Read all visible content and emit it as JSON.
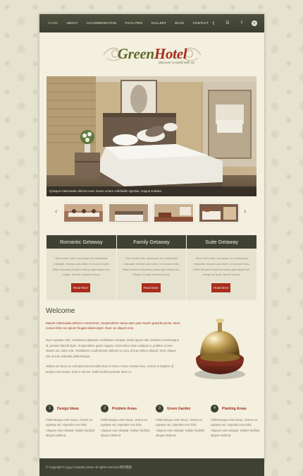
{
  "nav": {
    "items": [
      "Home",
      "About",
      "Accommodation",
      "Facilities",
      "Gallery",
      "Blog",
      "Contact"
    ],
    "active_index": 0,
    "social_icons": [
      "twitter-icon",
      "google-icon",
      "facebook-icon",
      "pinterest-icon"
    ],
    "social_glyphs": [
      "𝕥",
      "G",
      "f",
      "p"
    ]
  },
  "logo": {
    "green": "Green",
    "hotel": "Hotel",
    "tagline": "discover a world with us"
  },
  "hero": {
    "caption": "Quisque malesuada ultricies nunc maurs ornare solicitadin egestas, magna sodales."
  },
  "features": [
    {
      "title": "Romantic Getaway",
      "text": "Nunc tortor ante, accumsan vel malesuada vulputate, tempus quis dolor. In et purus nulla. Etiam tincidunt pharetra metus eget aliquet leo. Integer mi ante, laoreet cursus.",
      "button": "Read More"
    },
    {
      "title": "Family Getaway",
      "text": "Nunc tortor ante, accumsan vel malesuada vulputate, tempus quis dolor. In et purus nulla. Etiam tincidunt pharetra metus eget aliquet leo. Integer mi ante, laoreet cursus.",
      "button": "Read More"
    },
    {
      "title": "Suite Getaway",
      "text": "Nunc tortor ante, accumsan vel malesuada vulputate, tempus quis dolor. In et purus nulla. Etiam tincidunt pharetra metus eget aliquet leo. Integer mi ante, laoreet cursus.",
      "button": "Read More"
    }
  ],
  "welcome": {
    "title": "Welcome",
    "highlight": "Mauris malesuada ultricies consectetur. Suspendisse varius ante quis mauris gravida auctor. Nunc cursus felis non ipsum feugiat ullamcorper. Nunc ac aliquet eros.",
    "paragraph1": "Nunc egestas velit. Vestibulum dignissim vestibulum volutpat. Morbi quam odio, facilisis ut scelerisque id, pretium blandit diam. Suspendisse quam magna, consectetur vitae volutpat et, porttitor ut sem. Mauris nec dolor erat. Vestibulum condimentum dolores eu arcu id erat ultrices aliquet. Nunc aliquet nisl at erat vulputate pellentesque.",
    "paragraph2": "Nullam vel lacus ac velit placerat convallis vitae in lorem. Fusce massa risus, viverra at dapibus id, tempus sed metus. Duis in elit nisi. Nulla facilisis pulvinar dolor et."
  },
  "bottom_columns": [
    {
      "number": "1",
      "title": "Design Ideas",
      "text": "Pellentesque enim lacus, viverra eu egestas vel, imperdiet non felis. Aliquam erat volutpat. Nullam facilisis aliquet eleifend."
    },
    {
      "number": "2",
      "title": "Problem Areas",
      "text": "Pellentesque enim lacus, viverra eu egestas vel, imperdiet non felis. Aliquam erat volutpat. Nullam facilisis aliquet eleifend."
    },
    {
      "number": "3",
      "title": "Green Garden",
      "text": "Pellentesque enim lacus, viverra eu egestas vel, imperdiet non felis. Aliquam erat volutpat. Nullam facilisis aliquet eleifend."
    },
    {
      "number": "4",
      "title": "Planting Areas",
      "text": "Pellentesque enim lacus, viverra eu egestas vel, imperdiet non felis. Aliquam erat volutpat. Nullam facilisis aliquet eleifend."
    }
  ],
  "footer": {
    "copyright": "© Copyright © yyyy Company name All rights reserved.网页模板"
  },
  "colors": {
    "accent_red": "#a92d1d",
    "dark_olive": "#3f4233",
    "page_bg": "#f3f0df",
    "logo_green": "#5f6b2c"
  }
}
